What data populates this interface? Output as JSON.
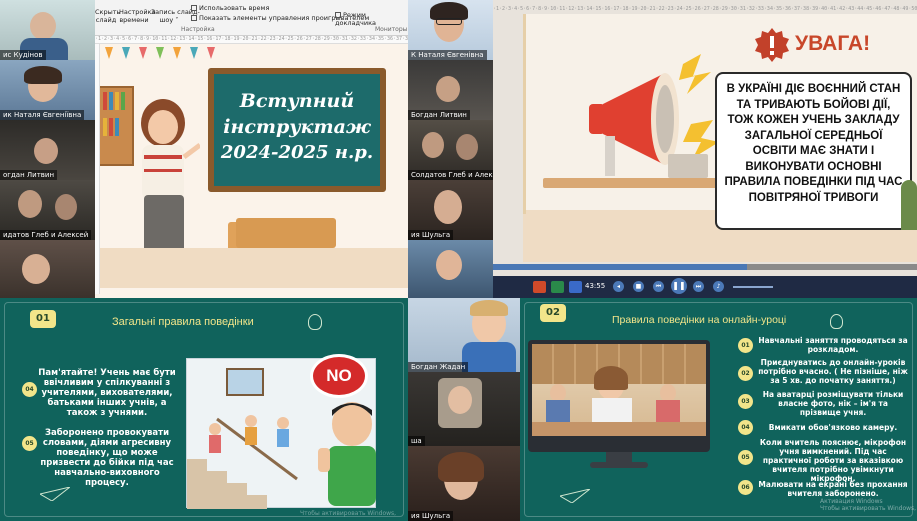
{
  "participants": [
    {
      "name": "ис Кудінов"
    },
    {
      "name": "ик Наталя Євгеніївна"
    },
    {
      "name": "огдан Литвин"
    },
    {
      "name": "идатов Глеб и Алексей"
    },
    {
      "name": "К Наталя Євгенівна"
    },
    {
      "name": "Богдан Литвин"
    },
    {
      "name": "Солдатов Глеб и Алексей"
    },
    {
      "name": "ия Шульга"
    },
    {
      "name": "Богдан Жадан"
    },
    {
      "name": "ша"
    },
    {
      "name": "ия Шульга"
    }
  ],
  "ribbon": {
    "hide_slide": "Скрыть\nслайд",
    "timing": "Настройка\nвремени",
    "record": "Запись слайд-\nшоу ˅",
    "use_timing": "Использовать время",
    "show_controls": "Показать элементы управления проигрывателем",
    "presenter_mode": "Режим докладчика",
    "group_setup": "Настройка",
    "group_monitors": "Мониторы"
  },
  "slide1": {
    "title_line1": "Вступний",
    "title_line2": "інструктаж",
    "title_line3": "2024-2025 н.р."
  },
  "slide2": {
    "warning": "УВАГА!",
    "text": "В УКРАЇНІ ДІЄ ВОЄННИЙ СТАН ТА ТРИВАЮТЬ БОЙОВІ ДІЇ, ТОЖ КОЖЕН УЧЕНЬ ЗАКЛАДУ ЗАГАЛЬНОЇ СЕРЕДНЬОЇ ОСВІТИ МАЄ ЗНАТИ І ВИКОНУВАТИ ОСНОВНІ ПРАВИЛА ПОВЕДІНКИ ПІД ЧАС ПОВІТРЯНОЇ ТРИВОГИ",
    "time": "43:55",
    "watermark": "Активация Windows"
  },
  "slide3": {
    "badge": "01",
    "title": "Загальні правила поведінки",
    "rule1": "Пам'ятайте! Учень має бути ввічливим у спілкуванні з учителями, вихователями, батьками інших учнів, а також з учнями.",
    "rule2": "Заборонено провокувати словами, діями агресивну поведінку, що може призвести до бійки під час навчально-виховного процесу.",
    "num1": "04",
    "num2": "05",
    "no": "NO"
  },
  "slide4": {
    "badge": "02",
    "title": "Правила поведінки на онлайн-уроці",
    "rules": [
      {
        "n": "01",
        "t": "Навчальні заняття проводяться за розкладом."
      },
      {
        "n": "02",
        "t": "Приєднуватись до онлайн-уроків потрібно вчасно. ( Не пізніше, ніж за 5 хв. до початку заняття.)"
      },
      {
        "n": "03",
        "t": "На аватарці розміщувати тільки власне фото, нік – ім'я та прізвище учня."
      },
      {
        "n": "04",
        "t": "Вмикати обов'язково камеру."
      },
      {
        "n": "05",
        "t": "Коли вчитель пояснює, мікрофон учня вимкнений. Під час практичної роботи за вказівкою вчителя потрібно увімкнути мікрофон."
      },
      {
        "n": "06",
        "t": "Малювати на екрані без прохання вчителя заборонено."
      }
    ],
    "watermark": "Активация Windows\nЧтобы активировать Windows, ..."
  },
  "watermark_small": "Чтобы активировать Windows,",
  "colors": {
    "board": "#1d6b6b",
    "slide_green": "#10635c",
    "warn": "#c8472a"
  }
}
